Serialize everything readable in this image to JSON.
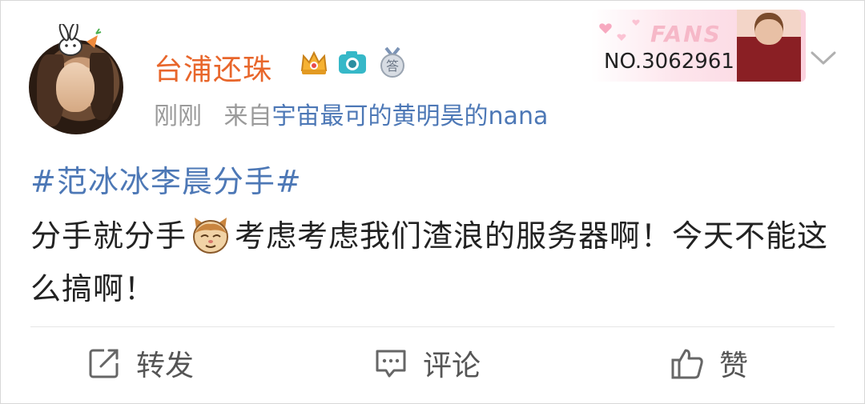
{
  "post": {
    "username": "台浦还珠",
    "time": "刚刚",
    "source_prefix": "来自",
    "source_name": "宇宙最可的黄明昊的nana",
    "topic": "#范冰冰李晨分手#",
    "text_part1": "分手就分手",
    "text_part2": "考虑考虑我们渣浪的服务器啊！今天不能这么搞啊！"
  },
  "fans_card": {
    "title": "FANS",
    "number": "NO.3062961"
  },
  "actions": {
    "repost": "转发",
    "comment": "评论",
    "like": "赞"
  },
  "colors": {
    "username": "#e8662b",
    "link": "#4d78b6",
    "meta": "#9a9a9a",
    "text": "#222222"
  },
  "icons": {
    "crown": "crown-badge-icon",
    "camera": "camera-badge-icon",
    "medal": "answer-medal-icon",
    "repost": "repost-icon",
    "comment": "comment-icon",
    "like": "thumbs-up-icon",
    "more": "chevron-down-icon"
  }
}
